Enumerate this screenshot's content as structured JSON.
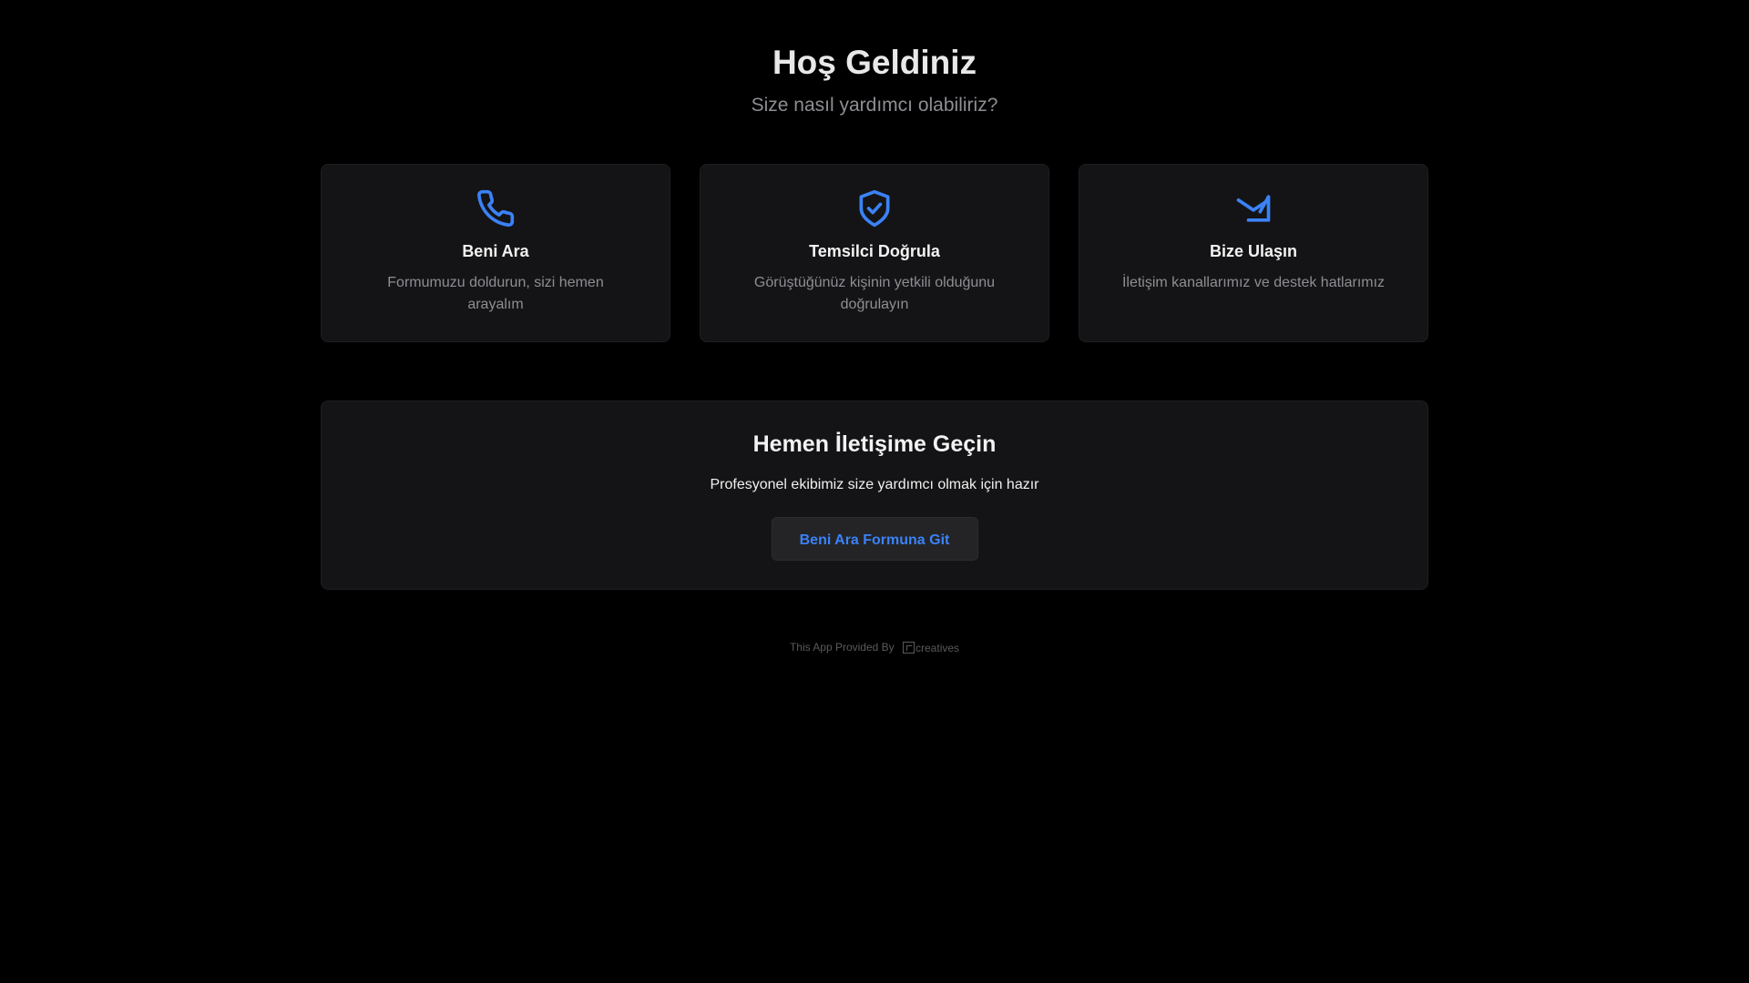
{
  "hero": {
    "title": "Hoş Geldiniz",
    "subtitle": "Size nasıl yardımcı olabiliriz?"
  },
  "cards": [
    {
      "icon": "phone-icon",
      "title": "Beni Ara",
      "description": "Formumuzu doldurun, sizi hemen arayalım"
    },
    {
      "icon": "shield-check-icon",
      "title": "Temsilci Doğrula",
      "description": "Görüştüğünüz kişinin yetkili olduğunu doğrulayın"
    },
    {
      "icon": "send-icon",
      "title": "Bize Ulaşın",
      "description": "İletişim kanallarımız ve destek hatlarımız"
    }
  ],
  "cta": {
    "title": "Hemen İletişime Geçin",
    "description": "Profesyonel ekibimiz size yardımcı olmak için hazır",
    "button_label": "Beni Ara Formuna Git"
  },
  "footer": {
    "provided_by": "This App Provided By",
    "brand": "creatives"
  },
  "colors": {
    "accent": "#3b82f6",
    "background": "#000000",
    "card": "#141416"
  }
}
